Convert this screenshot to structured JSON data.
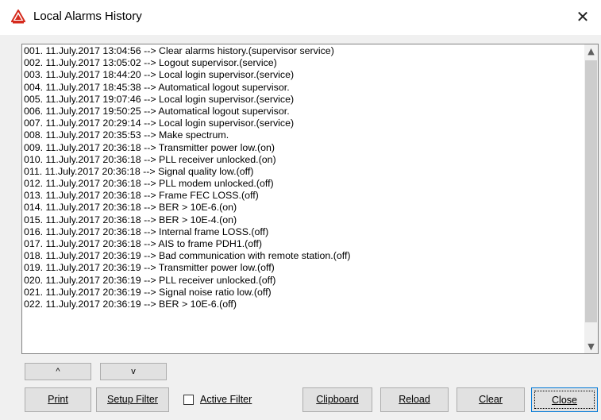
{
  "window": {
    "title": "Local Alarms History",
    "close_glyph": "✕",
    "accent_color": "#d52b1e"
  },
  "alarms": [
    "001. 11.July.2017 13:04:56 --> Clear alarms history.(supervisor service)",
    "002. 11.July.2017 13:05:02 --> Logout supervisor.(service)",
    "003. 11.July.2017 18:44:20 --> Local login supervisor.(service)",
    "004. 11.July.2017 18:45:38 --> Automatical logout supervisor.",
    "005. 11.July.2017 19:07:46 --> Local login supervisor.(service)",
    "006. 11.July.2017 19:50:25 --> Automatical logout supervisor.",
    "007. 11.July.2017 20:29:14 --> Local login supervisor.(service)",
    "008. 11.July.2017 20:35:53 --> Make spectrum.",
    "009. 11.July.2017 20:36:18 --> Transmitter power low.(on)",
    "010. 11.July.2017 20:36:18 --> PLL receiver unlocked.(on)",
    "011. 11.July.2017 20:36:18 --> Signal quality low.(off)",
    "012. 11.July.2017 20:36:18 --> PLL modem unlocked.(off)",
    "013. 11.July.2017 20:36:18 --> Frame FEC LOSS.(off)",
    "014. 11.July.2017 20:36:18 --> BER > 10E-6.(on)",
    "015. 11.July.2017 20:36:18 --> BER > 10E-4.(on)",
    "016. 11.July.2017 20:36:18 --> Internal frame LOSS.(off)",
    "017. 11.July.2017 20:36:18 --> AIS to frame PDH1.(off)",
    "018. 11.July.2017 20:36:19 --> Bad communication with remote station.(off)",
    "019. 11.July.2017 20:36:19 --> Transmitter power low.(off)",
    "020. 11.July.2017 20:36:19 --> PLL receiver unlocked.(off)",
    "021. 11.July.2017 20:36:19 --> Signal noise ratio low.(off)",
    "022. 11.July.2017 20:36:19 --> BER > 10E-6.(off)"
  ],
  "scrollbar": {
    "up_glyph": "▲",
    "down_glyph": "▼"
  },
  "nav": {
    "up_label": "^",
    "down_label": "v"
  },
  "buttons": {
    "print": "Print",
    "setup_filter": "Setup Filter",
    "clipboard": "Clipboard",
    "reload": "Reload",
    "clear": "Clear",
    "close": "Close"
  },
  "active_filter": {
    "label": "Active Filter",
    "checked": false
  }
}
